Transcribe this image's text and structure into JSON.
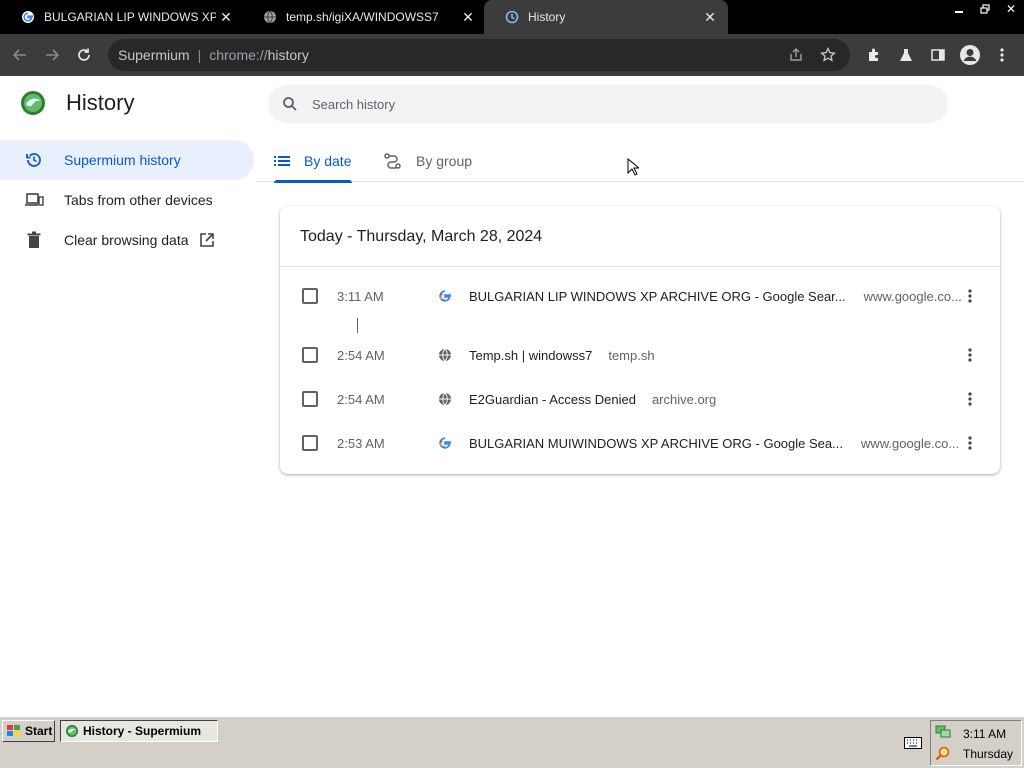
{
  "tabs": [
    {
      "title": "BULGARIAN LIP WINDOWS XP ARCHIVE ORG - Google Search",
      "favicon": "google-icon",
      "active": false
    },
    {
      "title": "temp.sh/igiXA/WINDOWSS7",
      "favicon": "globe-icon",
      "active": false
    },
    {
      "title": "History",
      "favicon": "history-icon",
      "active": true
    }
  ],
  "toolbar": {
    "site_name": "Supermium",
    "url_scheme": "chrome://",
    "url_path": "history"
  },
  "page": {
    "title": "History",
    "search_placeholder": "Search history"
  },
  "sidebar": {
    "items": [
      {
        "label": "Supermium history",
        "icon": "history-icon",
        "active": true
      },
      {
        "label": "Tabs from other devices",
        "icon": "devices-icon",
        "active": false
      },
      {
        "label": "Clear browsing data",
        "icon": "trash-icon",
        "active": false
      }
    ]
  },
  "view_tabs": [
    {
      "label": "By date",
      "icon": "list-icon",
      "active": true
    },
    {
      "label": "By group",
      "icon": "group-icon",
      "active": false
    }
  ],
  "history": {
    "day_header": "Today - Thursday, March 28, 2024",
    "entries": [
      {
        "time": "3:11 AM",
        "title": "BULGARIAN LIP WINDOWS XP ARCHIVE ORG - Google Sear...",
        "domain": "www.google.co...",
        "favicon": "google-icon"
      },
      {
        "time": "2:54 AM",
        "title": "Temp.sh | windowss7",
        "domain": "temp.sh",
        "favicon": "globe-icon"
      },
      {
        "time": "2:54 AM",
        "title": "E2Guardian - Access Denied",
        "domain": "archive.org",
        "favicon": "globe-icon"
      },
      {
        "time": "2:53 AM",
        "title": "BULGARIAN MUIWINDOWS XP ARCHIVE ORG - Google Sea...",
        "domain": "www.google.co...",
        "favicon": "google-icon"
      }
    ]
  },
  "taskbar": {
    "start_label": "Start",
    "task_label": "History - Supermium",
    "clock_time": "3:11 AM",
    "clock_day": "Thursday"
  },
  "colors": {
    "accent": "#0b57d0",
    "active_bg": "#e8f0fe",
    "toolbar_bg": "#3c3c3c",
    "tabstrip_bg": "#000000"
  }
}
